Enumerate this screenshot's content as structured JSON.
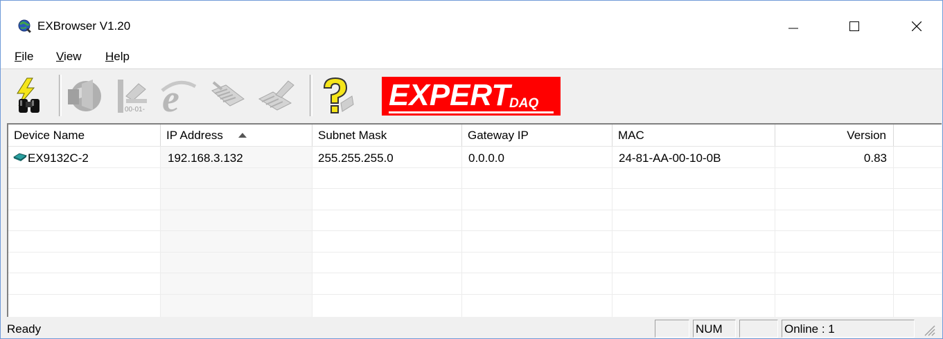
{
  "window": {
    "title": "EXBrowser V1.20",
    "controls": {
      "minimize": "minimize-icon",
      "maximize": "maximize-icon",
      "close": "close-icon"
    }
  },
  "menu": {
    "items": [
      "File",
      "View",
      "Help"
    ]
  },
  "toolbar": {
    "buttons": [
      {
        "icon": "search-binoculars-icon",
        "enabled": true
      },
      {
        "icon": "network-globe-icon",
        "enabled": false
      },
      {
        "icon": "set-ip-icon",
        "enabled": false
      },
      {
        "icon": "internet-explorer-icon",
        "enabled": false
      },
      {
        "icon": "module-icon",
        "enabled": false
      },
      {
        "icon": "module-config-icon",
        "enabled": false
      },
      {
        "icon": "help-icon",
        "enabled": true
      }
    ],
    "logo": {
      "main": "EXPERT",
      "sub": "DAQ"
    }
  },
  "table": {
    "columns": [
      "Device Name",
      "IP Address",
      "Subnet Mask",
      "Gateway IP",
      "MAC",
      "Version"
    ],
    "sorted_column": "IP Address",
    "sort_direction": "ascending",
    "rows": [
      {
        "device_name": "EX9132C-2",
        "ip_address": "192.168.3.132",
        "subnet_mask": "255.255.255.0",
        "gateway_ip": "0.0.0.0",
        "mac": "24-81-AA-00-10-0B",
        "version": "0.83"
      }
    ]
  },
  "status": {
    "text": "Ready",
    "panes": [
      "",
      "NUM",
      "",
      "Online : 1"
    ]
  },
  "colors": {
    "logo_bg": "#ff0000",
    "window_bg": "#f0f0f0",
    "titlebar_bg": "#ffffff",
    "device_icon": "#1f8c8c"
  }
}
